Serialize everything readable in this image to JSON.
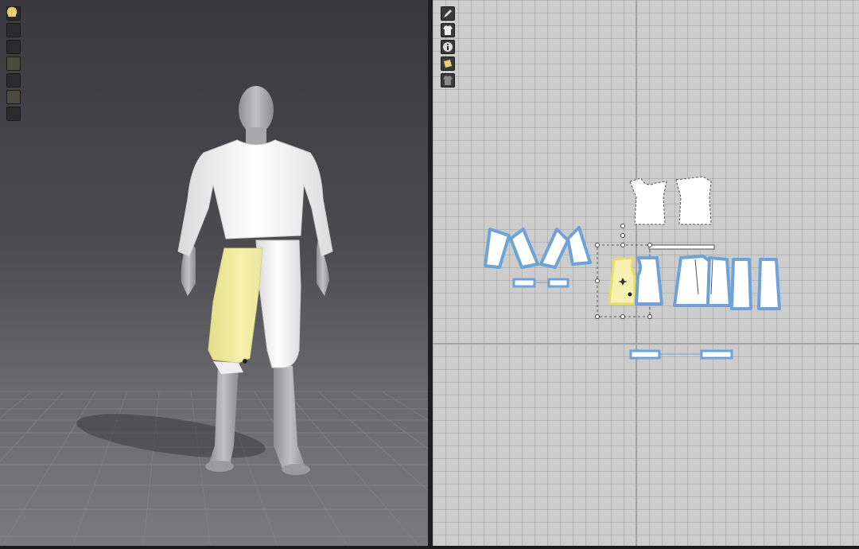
{
  "window": {
    "panels": [
      "3d-garment-window",
      "2d-pattern-window"
    ]
  },
  "toolbar3d": {
    "tools": [
      {
        "name": "garment-display-icon",
        "active": false
      },
      {
        "name": "texture-display-icon",
        "active": false
      },
      {
        "name": "avatar-display-icon",
        "active": false
      },
      {
        "name": "fabric-display-icon",
        "active": true
      },
      {
        "name": "pattern-shading-icon",
        "active": false
      },
      {
        "name": "avatar-skin-icon",
        "active": true
      },
      {
        "name": "grid-display-icon",
        "active": false
      }
    ]
  },
  "toolbar2d": {
    "tools": [
      {
        "name": "pattern-edit-icon",
        "active": false
      },
      {
        "name": "garment-view-icon",
        "active": false
      },
      {
        "name": "info-icon",
        "active": false
      },
      {
        "name": "fabric-swatch-icon",
        "active": true
      },
      {
        "name": "shade-icon",
        "active": false
      }
    ]
  },
  "colors": {
    "garment": "#f2f2f2",
    "selected_fabric": "#f1ec9e",
    "pattern_outline": "#6fa2d6",
    "avatar": "#a9a9ab"
  }
}
